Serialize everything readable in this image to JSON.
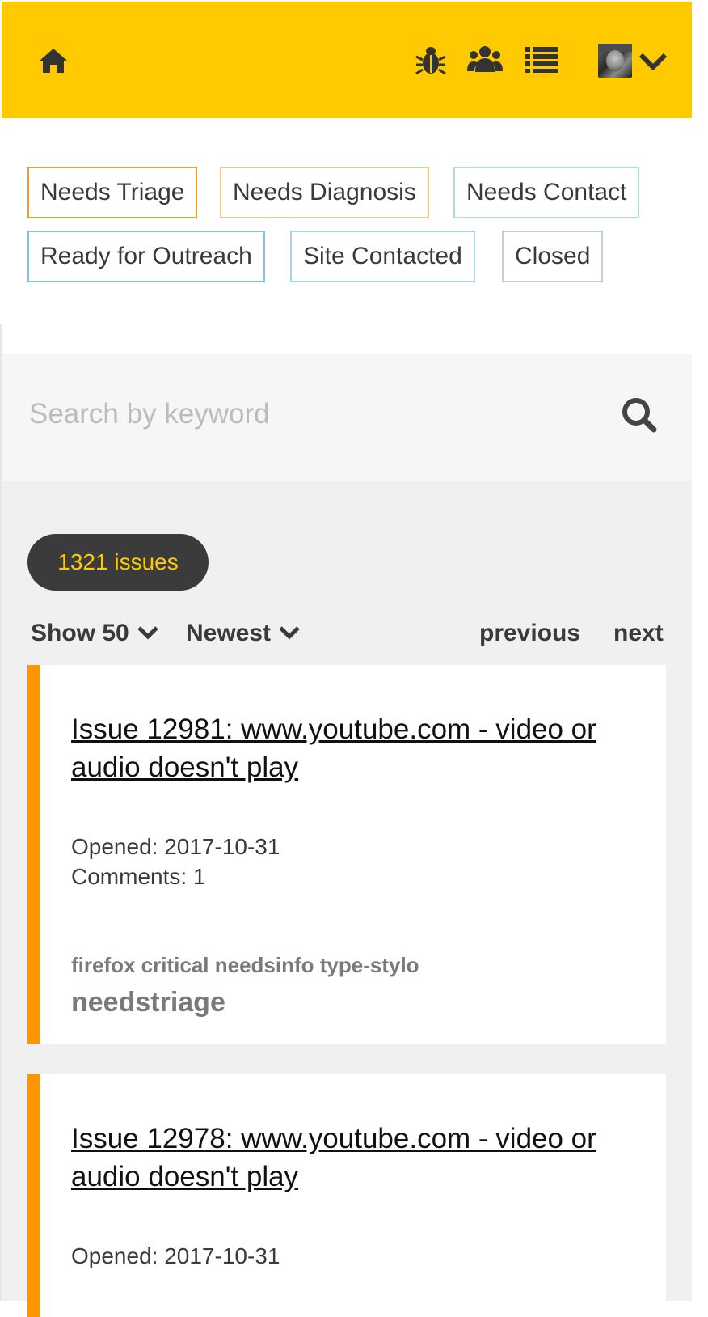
{
  "nav": {
    "home_icon": "home-icon",
    "icons": [
      "bug-icon",
      "team-icon",
      "list-icon",
      "avatar",
      "chevron-down-icon"
    ],
    "accent": "#ffcb00"
  },
  "labels": [
    {
      "text": "Needs Triage",
      "color": "#f19c2e"
    },
    {
      "text": "Needs Diagnosis",
      "color": "#f1c57f"
    },
    {
      "text": "Needs Contact",
      "color": "#a7e4c5"
    },
    {
      "text": "Ready for Outreach",
      "color": "#80c3e3"
    },
    {
      "text": "Site Contacted",
      "color": "#a6d6ea"
    },
    {
      "text": "Closed",
      "color": "#c3cdd4"
    }
  ],
  "search": {
    "placeholder": "Search by keyword",
    "icon": "search-icon"
  },
  "list": {
    "count_label": "1321 issues",
    "show_label": "Show 50",
    "sort_label": "Newest",
    "previous_label": "previous",
    "next_label": "next"
  },
  "issues": [
    {
      "number": "Issue 12981",
      "title": ": www.youtube.com - video or audio doesn't play",
      "opened": "Opened: 2017-10-31",
      "comments": "Comments: 1",
      "tags": "firefox critical needsinfo type-stylo",
      "status_tag": "needstriage"
    },
    {
      "number": "Issue 12978",
      "title": ": www.youtube.com - video or audio doesn't play",
      "opened": "Opened: 2017-10-31"
    }
  ]
}
